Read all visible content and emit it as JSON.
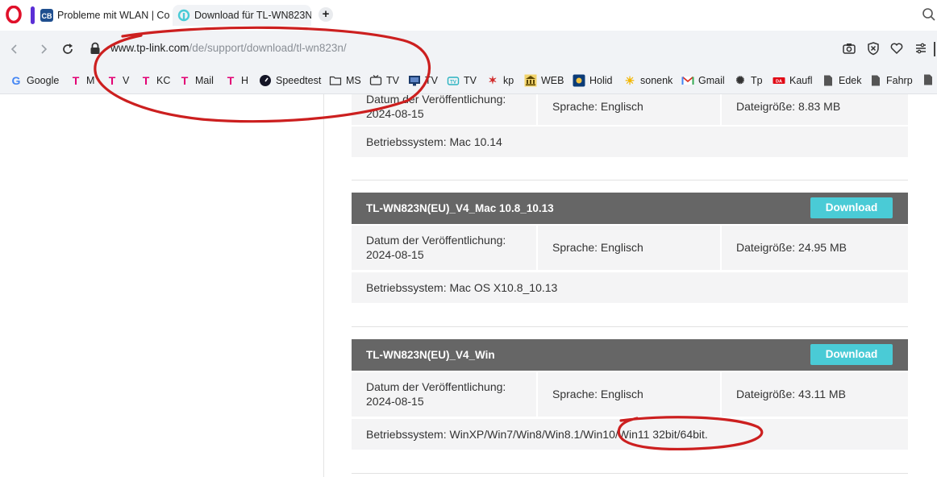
{
  "browser": {
    "tabs": [
      {
        "label": "Probleme mit WLAN | Con"
      },
      {
        "label": "Download für TL-WN823N"
      }
    ],
    "url": {
      "host": "www.tp-link.com",
      "path": "/de/support/download/tl-wn823n/"
    },
    "bookmarks": [
      {
        "label": "Google",
        "icon": "google-icon",
        "color": "#4285f4"
      },
      {
        "label": "M",
        "icon": "telekom-icon",
        "color": "#e20074"
      },
      {
        "label": "V",
        "icon": "telekom-icon",
        "color": "#e20074"
      },
      {
        "label": "KC",
        "icon": "telekom-icon",
        "color": "#e20074"
      },
      {
        "label": "Mail",
        "icon": "telekom-icon",
        "color": "#e20074"
      },
      {
        "label": "H",
        "icon": "telekom-icon",
        "color": "#e20074"
      },
      {
        "label": "Speedtest",
        "icon": "speedtest-icon",
        "color": "#141526"
      },
      {
        "label": "MS",
        "icon": "folder-icon",
        "color": "#333333"
      },
      {
        "label": "TV",
        "icon": "tv-icon",
        "color": "#333333"
      },
      {
        "label": "TV",
        "icon": "monitor-icon",
        "color": "#1a3a6b"
      },
      {
        "label": "TV",
        "icon": "tv-icon",
        "color": "#2bb3c0"
      },
      {
        "label": "kp",
        "icon": "kp-icon",
        "color": "#d12b2b"
      },
      {
        "label": "WEB",
        "icon": "bank-icon",
        "color": "#c9a227"
      },
      {
        "label": "Holid",
        "icon": "holiday-icon",
        "color": "#0c3c78"
      },
      {
        "label": "sonenk",
        "icon": "sun-icon",
        "color": "#f2b705"
      },
      {
        "label": "Gmail",
        "icon": "gmail-icon",
        "color": "#d93025"
      },
      {
        "label": "Tp",
        "icon": "satellite-icon",
        "color": "#333333"
      },
      {
        "label": "Kaufl",
        "icon": "kaufland-icon",
        "color": "#e10915"
      },
      {
        "label": "Edek",
        "icon": "file-icon",
        "color": "#333333"
      },
      {
        "label": "Fahrp",
        "icon": "file-icon",
        "color": "#333333"
      }
    ]
  },
  "downloads": [
    {
      "title": "",
      "date_label": "Datum der Veröffentlichung:",
      "date": "2024-08-15",
      "language": "Sprache: Englisch",
      "size": "Dateigröße: 8.83 MB",
      "os": "Betriebssystem: Mac 10.14"
    },
    {
      "title": "TL-WN823N(EU)_V4_Mac 10.8_10.13",
      "button": "Download",
      "date_label": "Datum der Veröffentlichung:",
      "date": "2024-08-15",
      "language": "Sprache: Englisch",
      "size": "Dateigröße: 24.95 MB",
      "os": "Betriebssystem: Mac OS X10.8_10.13"
    },
    {
      "title": "TL-WN823N(EU)_V4_Win",
      "button": "Download",
      "date_label": "Datum der Veröffentlichung:",
      "date": "2024-08-15",
      "language": "Sprache: Englisch",
      "size": "Dateigröße: 43.11 MB",
      "os": "Betriebssystem: WinXP/Win7/Win8/Win8.1/Win10/Win11 32bit/64bit."
    }
  ],
  "colors": {
    "header_bg": "#666666",
    "download_button": "#4acbd6",
    "annotation": "#cc1f1f"
  }
}
